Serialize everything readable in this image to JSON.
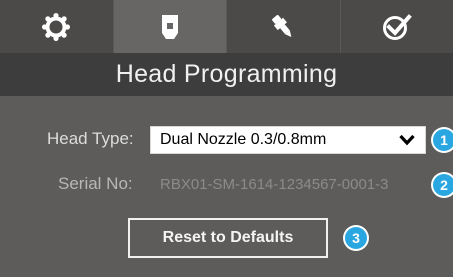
{
  "tabs": [
    {
      "icon": "gear-icon",
      "active": false
    },
    {
      "icon": "print-head-icon",
      "active": true
    },
    {
      "icon": "nozzle-tool-icon",
      "active": false
    },
    {
      "icon": "checkmark-icon",
      "active": false
    }
  ],
  "header": {
    "title": "Head Programming"
  },
  "form": {
    "head_type_label": "Head Type:",
    "head_type_value": "Dual Nozzle 0.3/0.8mm",
    "serial_label": "Serial No:",
    "serial_value": "RBX01-SM-1614-1234567-0001-3"
  },
  "actions": {
    "reset_label": "Reset to Defaults"
  },
  "callouts": {
    "one": "1",
    "two": "2",
    "three": "3"
  },
  "colors": {
    "background": "#5d5c5a",
    "tab_bar": "#4b4a48",
    "tab_active": "#676664",
    "header_bar": "#3d3d3d",
    "callout_blue": "#2aa7e0"
  }
}
